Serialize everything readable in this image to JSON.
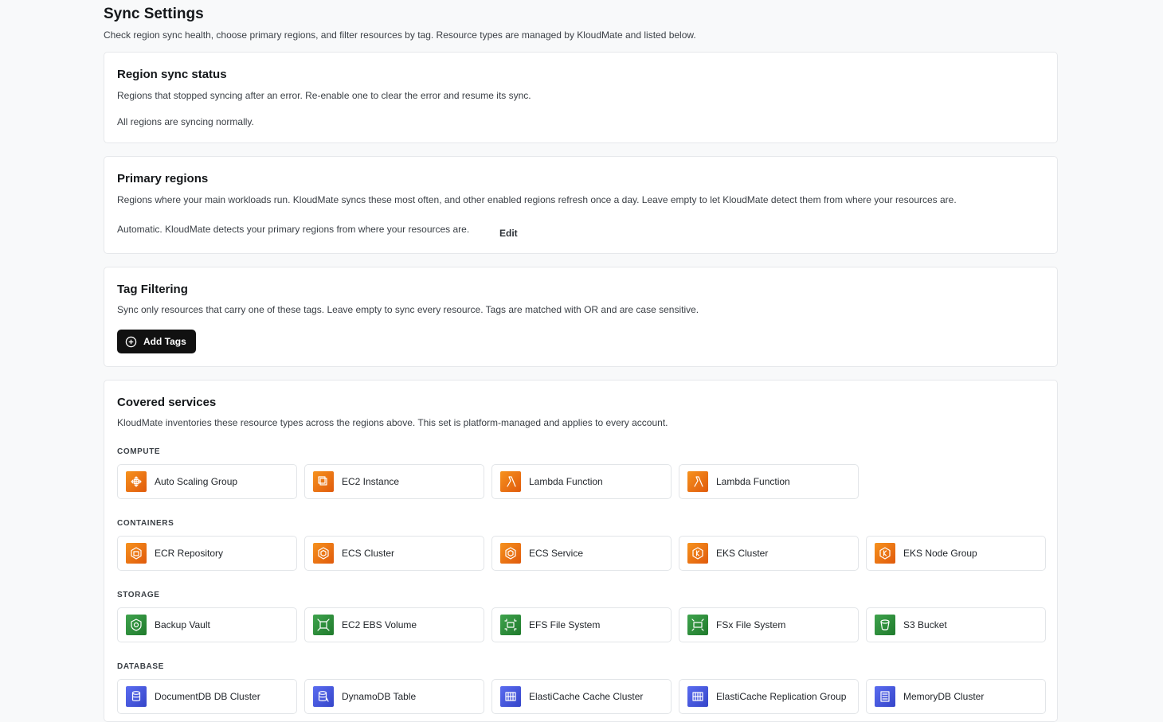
{
  "page": {
    "title": "Sync Settings",
    "subtitle": "Check region sync health, choose primary regions, and filter resources by tag. Resource types are managed by KloudMate and listed below."
  },
  "sync_status": {
    "title": "Region sync status",
    "description": "Regions that stopped syncing after an error. Re-enable one to clear the error and resume its sync.",
    "status_text": "All regions are syncing normally."
  },
  "primary_regions": {
    "title": "Primary regions",
    "description": "Regions where your main workloads run. KloudMate syncs these most often, and other enabled regions refresh once a day. Leave empty to let KloudMate detect them from where your resources are.",
    "status_text": "Automatic. KloudMate detects your primary regions from where your resources are.",
    "edit_label": "Edit"
  },
  "tag_filtering": {
    "title": "Tag Filtering",
    "description": "Sync only resources that carry one of these tags. Leave empty to sync every resource. Tags are matched with OR and are case sensitive.",
    "add_label": "Add Tags"
  },
  "services": {
    "title": "Covered services",
    "description": "KloudMate inventories these resource types across the regions above. This set is platform-managed and applies to every account.",
    "groups": [
      {
        "label": "COMPUTE",
        "color": "orange",
        "items": [
          {
            "label": "Auto Scaling Group",
            "icon": "auto-scaling-icon"
          },
          {
            "label": "EC2 Instance",
            "icon": "ec2-icon"
          },
          {
            "label": "Lambda Function",
            "icon": "lambda-icon"
          },
          {
            "label": "Lambda Function",
            "icon": "lambda-icon"
          }
        ]
      },
      {
        "label": "CONTAINERS",
        "color": "orange",
        "items": [
          {
            "label": "ECR Repository",
            "icon": "ecr-icon"
          },
          {
            "label": "ECS Cluster",
            "icon": "ecs-icon"
          },
          {
            "label": "ECS Service",
            "icon": "ecs-icon"
          },
          {
            "label": "EKS Cluster",
            "icon": "eks-icon"
          },
          {
            "label": "EKS Node Group",
            "icon": "eks-icon"
          }
        ]
      },
      {
        "label": "STORAGE",
        "color": "green",
        "items": [
          {
            "label": "Backup Vault",
            "icon": "backup-icon"
          },
          {
            "label": "EC2 EBS Volume",
            "icon": "ebs-icon"
          },
          {
            "label": "EFS File System",
            "icon": "efs-icon"
          },
          {
            "label": "FSx File System",
            "icon": "fsx-icon"
          },
          {
            "label": "S3 Bucket",
            "icon": "s3-bucket-icon"
          }
        ]
      },
      {
        "label": "DATABASE",
        "color": "blue",
        "items": [
          {
            "label": "DocumentDB DB Cluster",
            "icon": "documentdb-icon"
          },
          {
            "label": "DynamoDB Table",
            "icon": "dynamodb-icon"
          },
          {
            "label": "ElastiCache Cache Cluster",
            "icon": "elasticache-icon"
          },
          {
            "label": "ElastiCache Replication Group",
            "icon": "elasticache-icon"
          },
          {
            "label": "MemoryDB Cluster",
            "icon": "memorydb-icon"
          }
        ]
      }
    ]
  },
  "colors": {
    "compute_orange": "#f6921e",
    "storage_green": "#3fa34d",
    "database_blue": "#5a6cf0",
    "button_black": "#111111"
  }
}
